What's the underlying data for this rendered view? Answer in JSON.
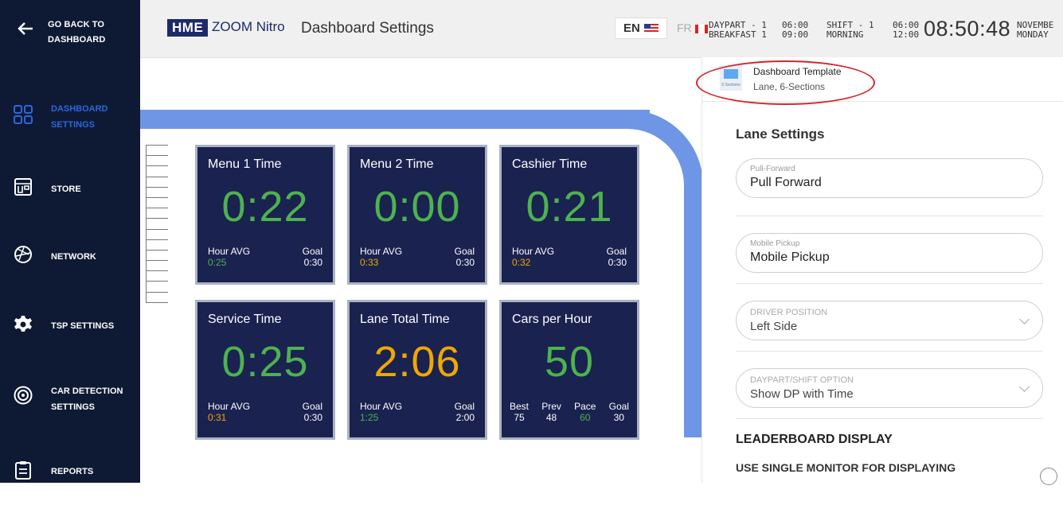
{
  "sidebar": {
    "back_label": "GO BACK TO DASHBOARD",
    "items": [
      {
        "label": "DASHBOARD SETTINGS",
        "icon": "dashboard-grid-icon",
        "active": true
      },
      {
        "label": "STORE",
        "icon": "store-icon"
      },
      {
        "label": "NETWORK",
        "icon": "network-icon"
      },
      {
        "label": "TSP SETTINGS",
        "icon": "gear-icon"
      },
      {
        "label": "CAR DETECTION SETTINGS",
        "icon": "car-detection-icon"
      },
      {
        "label": "REPORTS",
        "icon": "reports-clipboard-icon"
      }
    ]
  },
  "header": {
    "logo_hme": "HME",
    "logo_product": "ZOOM Nitro",
    "title": "Dashboard Settings",
    "lang_en": "EN",
    "lang_fr": "FR",
    "daypart_line1": "DAYPART - 1",
    "daypart_line2": "BREAKFAST 1",
    "daypart_time1": "06:00",
    "daypart_time2": "09:00",
    "shift_line1": "SHIFT - 1",
    "shift_line2": "MORNING",
    "shift_time1": "06:00",
    "shift_time2": "12:00",
    "clock": "08:50:48",
    "date_line1": "NOVEMBE",
    "date_line2": "MONDAY"
  },
  "tiles": [
    {
      "title": "Menu 1 Time",
      "value": "0:22",
      "value_color": "green",
      "avg_label": "Hour AVG",
      "avg_value": "0:25",
      "avg_color": "green",
      "goal_label": "Goal",
      "goal_value": "0:30"
    },
    {
      "title": "Menu 2 Time",
      "value": "0:00",
      "value_color": "green",
      "avg_label": "Hour AVG",
      "avg_value": "0:33",
      "avg_color": "orange",
      "goal_label": "Goal",
      "goal_value": "0:30"
    },
    {
      "title": "Cashier Time",
      "value": "0:21",
      "value_color": "green",
      "avg_label": "Hour AVG",
      "avg_value": "0:32",
      "avg_color": "orange",
      "goal_label": "Goal",
      "goal_value": "0:30"
    },
    {
      "title": "Service Time",
      "value": "0:25",
      "value_color": "green",
      "avg_label": "Hour AVG",
      "avg_value": "0:31",
      "avg_color": "orange",
      "goal_label": "Goal",
      "goal_value": "0:30"
    },
    {
      "title": "Lane Total Time",
      "value": "2:06",
      "value_color": "orange",
      "avg_label": "Hour AVG",
      "avg_value": "1:25",
      "avg_color": "green",
      "goal_label": "Goal",
      "goal_value": "2:00"
    },
    {
      "title": "Cars per Hour",
      "value": "50",
      "value_color": "green",
      "stats": [
        {
          "label": "Best",
          "value": "75"
        },
        {
          "label": "Prev",
          "value": "48"
        },
        {
          "label": "Pace",
          "value": "60",
          "color": "green"
        },
        {
          "label": "Goal",
          "value": "30"
        }
      ]
    }
  ],
  "panel": {
    "template_title": "Dashboard Template",
    "template_subtitle": "Lane, 6-Sections",
    "template_icon_caption": "6 Sections",
    "section_title": "Lane Settings",
    "pull_forward_label": "Pull-Forward",
    "pull_forward_value": "Pull Forward",
    "mobile_pickup_label": "Mobile Pickup",
    "mobile_pickup_value": "Mobile Pickup",
    "driver_position_label": "DRIVER POSITION",
    "driver_position_value": "Left Side",
    "daypart_option_label": "DAYPART/SHIFT OPTION",
    "daypart_option_value": "Show DP with Time",
    "leaderboard_title": "LEADERBOARD DISPLAY",
    "single_monitor_label": "USE SINGLE MONITOR FOR DISPLAYING"
  },
  "colors": {
    "sidebar_bg": "#0e1a33",
    "active_accent": "#2b67e0",
    "tile_bg": "#1a2250",
    "lane_band": "#6f95e6",
    "green": "#4db24f",
    "orange": "#f0a800",
    "annotation_red": "#d9252b"
  }
}
